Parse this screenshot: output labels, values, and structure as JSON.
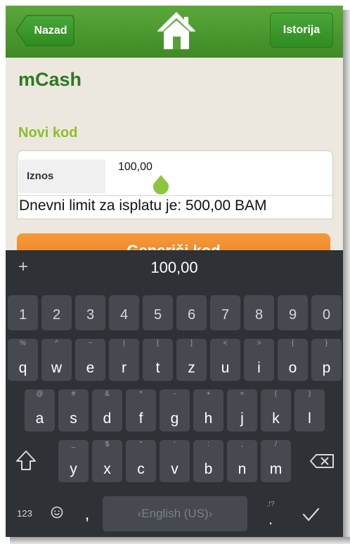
{
  "header": {
    "back_label": "Nazad",
    "history_label": "Istorija",
    "home_icon": "home-icon"
  },
  "page": {
    "title": "mCash",
    "section_title": "Novi kod"
  },
  "form": {
    "amount_label": "Iznos",
    "amount_value": "100,00",
    "daily_limit_text": "Dnevni limit za isplatu je: 500,00 BAM"
  },
  "generate_button_label": "Generiši kod",
  "keyboard": {
    "plus": "+",
    "suggestion": "100,00",
    "number_row": [
      "1",
      "2",
      "3",
      "4",
      "5",
      "6",
      "7",
      "8",
      "9",
      "0"
    ],
    "row1": [
      {
        "main": "q",
        "alt": "%"
      },
      {
        "main": "w",
        "alt": "^"
      },
      {
        "main": "e",
        "alt": "~"
      },
      {
        "main": "r",
        "alt": "|"
      },
      {
        "main": "t",
        "alt": "["
      },
      {
        "main": "z",
        "alt": "]"
      },
      {
        "main": "u",
        "alt": "<"
      },
      {
        "main": "i",
        "alt": ">"
      },
      {
        "main": "o",
        "alt": "{"
      },
      {
        "main": "p",
        "alt": "}"
      }
    ],
    "row2": [
      {
        "main": "a",
        "alt": "@"
      },
      {
        "main": "s",
        "alt": "#"
      },
      {
        "main": "d",
        "alt": "&"
      },
      {
        "main": "f",
        "alt": "*"
      },
      {
        "main": "g",
        "alt": "-"
      },
      {
        "main": "h",
        "alt": "+"
      },
      {
        "main": "j",
        "alt": "="
      },
      {
        "main": "k",
        "alt": "("
      },
      {
        "main": "l",
        "alt": ")"
      }
    ],
    "row3": [
      {
        "main": "y",
        "alt": "_"
      },
      {
        "main": "x",
        "alt": "$"
      },
      {
        "main": "c",
        "alt": "\""
      },
      {
        "main": "v",
        "alt": "'"
      },
      {
        "main": "b",
        "alt": ":"
      },
      {
        "main": "n",
        "alt": ";"
      },
      {
        "main": "m",
        "alt": "/"
      }
    ],
    "key_123": "123",
    "comma": ",",
    "space_label": "English (US)",
    "period_alt": ",!?",
    "period": "."
  }
}
